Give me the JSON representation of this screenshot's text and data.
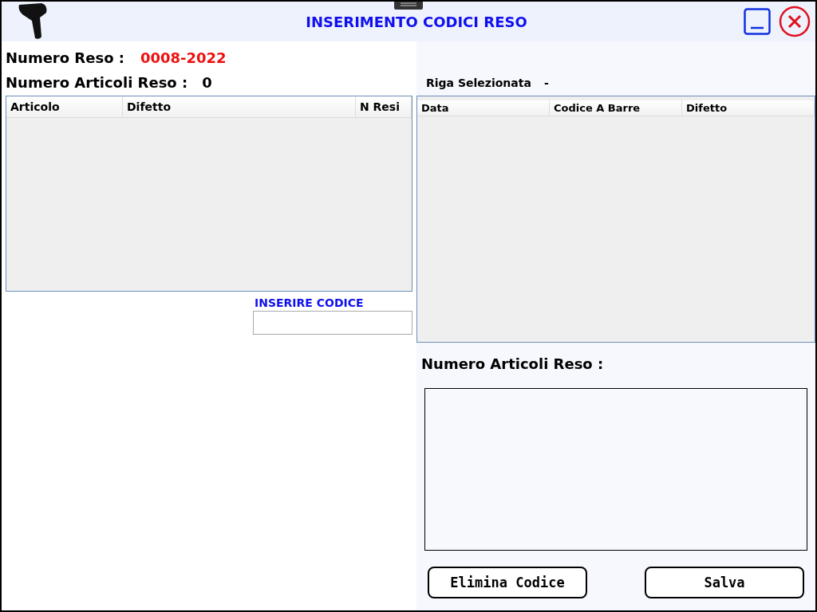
{
  "window": {
    "title": "INSERIMENTO CODICI RESO"
  },
  "numero_reso": {
    "label": "Numero Reso :",
    "value": "0008-2022"
  },
  "numero_articoli": {
    "label": "Numero Articoli Reso :",
    "value": "0"
  },
  "articoli_table": {
    "columns": [
      "Articolo",
      "Difetto",
      "N Resi"
    ]
  },
  "code_input": {
    "label": "INSERIRE CODICE"
  },
  "riga_selezionata": {
    "label": "Riga Selezionata",
    "value": "-"
  },
  "codici_table": {
    "columns": [
      "Data",
      "Codice A Barre",
      "Difetto"
    ]
  },
  "articoli_reso_label": "Numero Articoli Reso :",
  "buttons": [
    "Elimina Codice",
    "Salva"
  ]
}
